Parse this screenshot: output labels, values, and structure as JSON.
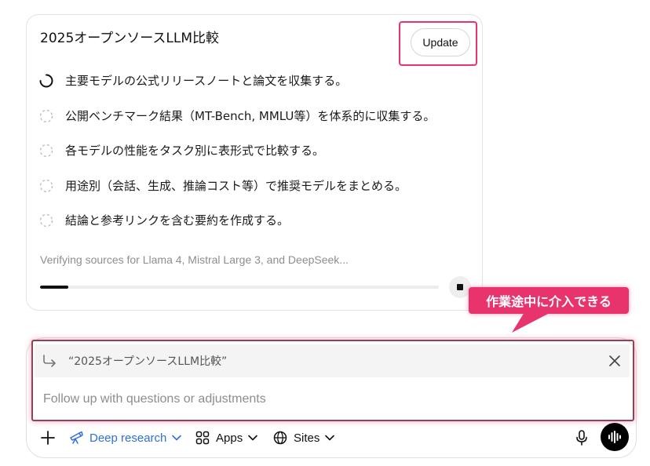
{
  "plan": {
    "title": "2025オープンソースLLM比較",
    "update_label": "Update",
    "steps": [
      {
        "text": "主要モデルの公式リリースノートと論文を収集する。",
        "state": "in-progress"
      },
      {
        "text": "公開ベンチマーク結果（MT-Bench, MMLU等）を体系的に収集する。",
        "state": "pending"
      },
      {
        "text": "各モデルの性能をタスク別に表形式で比較する。",
        "state": "pending"
      },
      {
        "text": "用途別（会話、生成、推論コスト等）で推奨モデルをまとめる。",
        "state": "pending"
      },
      {
        "text": "結論と参考リンクを含む要約を作成する。",
        "state": "pending"
      }
    ],
    "status_text": "Verifying sources for Llama 4, Mistral Large 3, and DeepSeek...",
    "progress_fraction": 0.07
  },
  "annotation": {
    "callout_text": "作業途中に介入できる",
    "accent_color": "#e8336d"
  },
  "composer": {
    "quote_text": "“2025オープンソースLLM比較”",
    "placeholder": "Follow up with questions or adjustments",
    "value": "",
    "toolbar": {
      "deep_research_label": "Deep research",
      "apps_label": "Apps",
      "sites_label": "Sites",
      "deep_research_color": "#2f6fde"
    }
  }
}
